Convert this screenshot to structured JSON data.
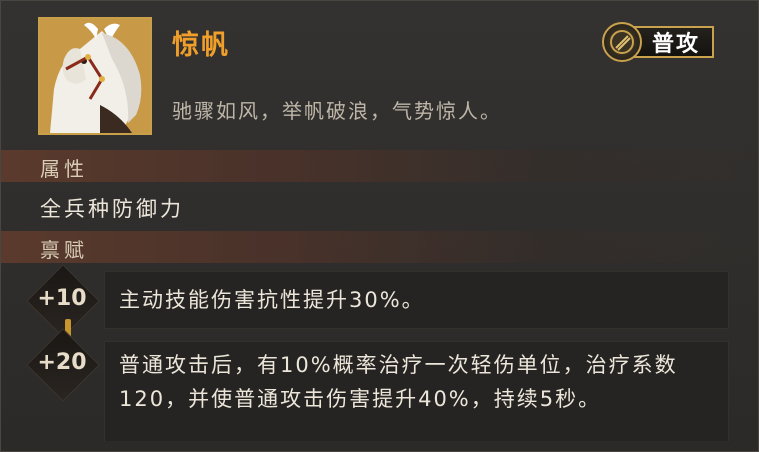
{
  "hero": {
    "name": "惊帆",
    "description": "驰骤如风，举帆破浪，气势惊人。",
    "attack_type": "普攻",
    "portrait_icon": "white-horse-portrait",
    "badge_icon": "sword-emblem-icon"
  },
  "attributes": {
    "title": "属性",
    "value": "全兵种防御力"
  },
  "talents": {
    "title": "禀赋",
    "items": [
      {
        "level": "+10",
        "text": "主动技能伤害抗性提升30%。"
      },
      {
        "level": "+20",
        "text": "普通攻击后，有10%概率治疗一次轻伤单位，治疗系数120，并使普通攻击伤害提升40%，持续5秒。"
      }
    ]
  },
  "colors": {
    "name": "#f0a02a",
    "badge_border": "#c9a24e",
    "section_bar": "#5a3a2c",
    "connector": "#c9952f"
  }
}
